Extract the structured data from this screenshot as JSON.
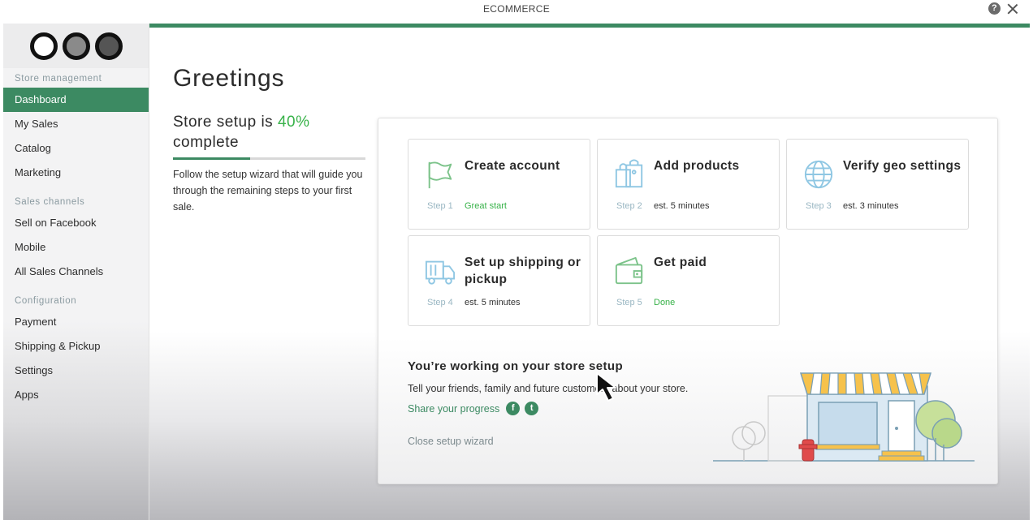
{
  "window": {
    "title": "ECOMMERCE",
    "help_icon": "question-circle-icon",
    "close_icon": "close-icon"
  },
  "sidebar": {
    "logo": "three-circles-logo",
    "sections": [
      {
        "label": "Store management",
        "items": [
          "Dashboard",
          "My Sales",
          "Catalog",
          "Marketing"
        ]
      },
      {
        "label": "Sales channels",
        "items": [
          "Sell on Facebook",
          "Mobile",
          "All Sales Channels"
        ]
      },
      {
        "label": "Configuration",
        "items": [
          "Payment",
          "Shipping & Pickup",
          "Settings",
          "Apps"
        ]
      }
    ],
    "active_item": "Dashboard"
  },
  "main": {
    "title": "Greetings",
    "setup": {
      "heading_prefix": "Store setup is",
      "percent": "40%",
      "heading_suffix": "complete",
      "progress_value": 0.4,
      "description": "Follow the setup wizard that will guide you through the remaining steps to your first sale."
    },
    "cards": [
      {
        "title": "Create account",
        "step": "Step 1",
        "status": "Great start",
        "icon": "flag-icon"
      },
      {
        "title": "Add products",
        "step": "Step 2",
        "status": "est. 5 minutes",
        "icon": "shopping-bags-icon"
      },
      {
        "title": "Verify geo settings",
        "step": "Step 3",
        "status": "est. 3 minutes",
        "icon": "globe-icon"
      },
      {
        "title": "Set up shipping or pickup",
        "step": "Step 4",
        "status": "est. 5 minutes",
        "icon": "delivery-truck-icon"
      },
      {
        "title": "Get paid",
        "step": "Step 5",
        "status": "Done",
        "icon": "wallet-icon"
      }
    ],
    "promo": {
      "title": "You’re working on your store setup",
      "text": "Tell your friends, family and future customers about your store.",
      "share_label": "Share your progress",
      "social": [
        {
          "icon": "facebook-icon",
          "glyph": "f"
        },
        {
          "icon": "twitter-icon",
          "glyph": "t"
        }
      ],
      "close_label": "Close setup wizard",
      "illustration": "storefront-illustration"
    }
  },
  "colors": {
    "accent": "#3c8a62",
    "progress_text": "#38b249",
    "icon_blue": "#8fc7e3",
    "muted_step": "#9ab7c3"
  }
}
